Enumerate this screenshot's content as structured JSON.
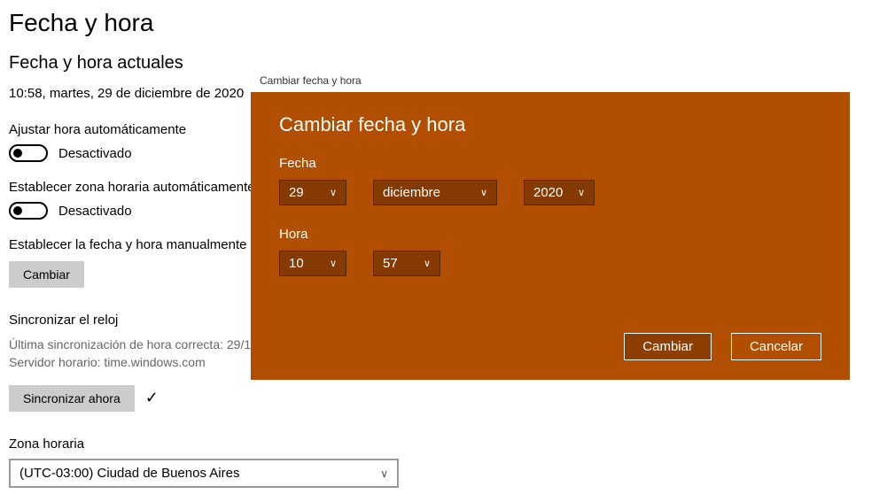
{
  "page": {
    "title": "Fecha y hora",
    "subtitle": "Fecha y hora actuales",
    "current_datetime": "10:58, martes, 29 de diciembre de 2020"
  },
  "auto_time": {
    "label": "Ajustar hora automáticamente",
    "state": "Desactivado"
  },
  "auto_tz": {
    "label": "Establecer zona horaria automáticamente",
    "state": "Desactivado"
  },
  "manual": {
    "label": "Establecer la fecha y hora manualmente",
    "button": "Cambiar"
  },
  "sync": {
    "heading": "Sincronizar el reloj",
    "last_line": "Última sincronización de hora correcta: 29/1",
    "server_line": "Servidor horario: time.windows.com",
    "button": "Sincronizar ahora"
  },
  "timezone": {
    "heading": "Zona horaria",
    "value": "(UTC-03:00) Ciudad de Buenos Aires"
  },
  "dialog": {
    "window_title": "Cambiar fecha y hora",
    "heading": "Cambiar fecha y hora",
    "date_label": "Fecha",
    "time_label": "Hora",
    "day": "29",
    "month": "diciembre",
    "year": "2020",
    "hour": "10",
    "minute": "57",
    "ok": "Cambiar",
    "cancel": "Cancelar"
  }
}
